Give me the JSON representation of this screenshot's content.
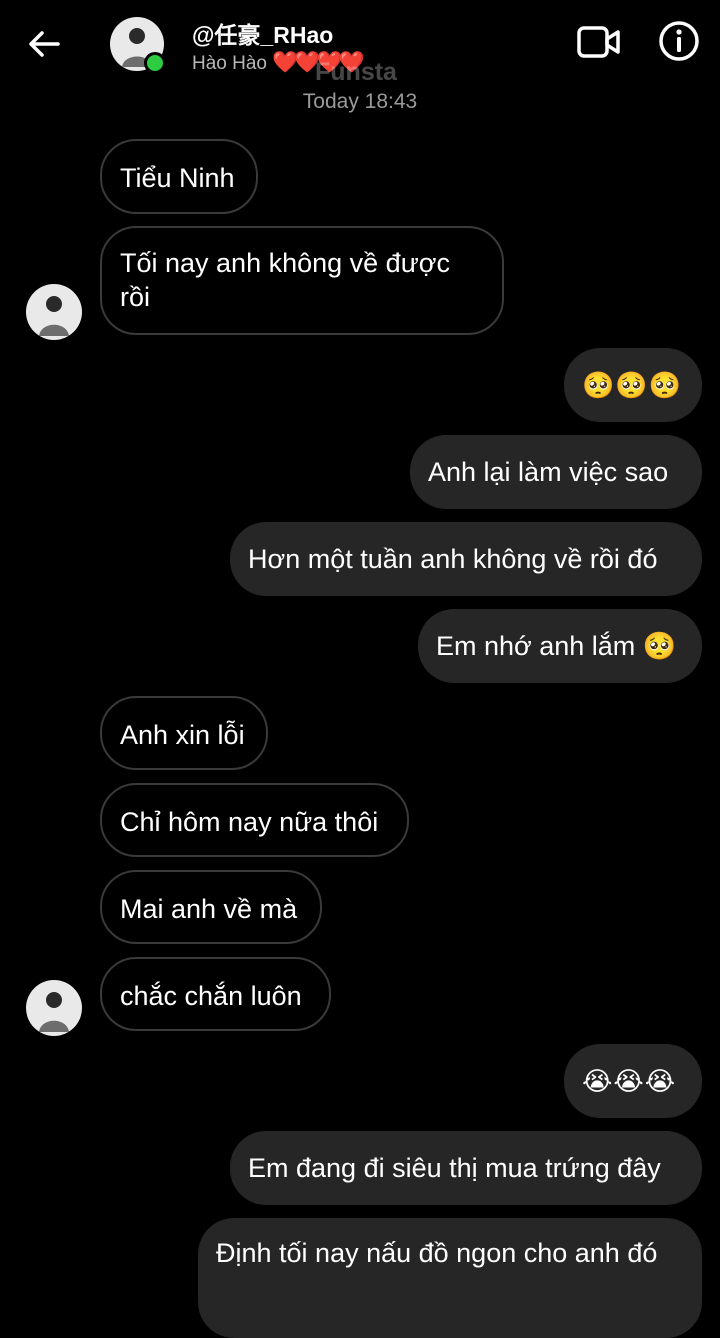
{
  "header": {
    "contact_name": "@任豪_RHao",
    "subtitle": "Hào Hào",
    "subtitle_hearts": "❤️❤️❤️❤️",
    "watermark": "Funsta"
  },
  "timestamp": "Today 18:43",
  "messages": [
    {
      "sender": "them",
      "text": "Tiểu Ninh"
    },
    {
      "sender": "them",
      "text": "Tối nay anh không về được rồi"
    },
    {
      "sender": "me",
      "text": "🥺🥺🥺"
    },
    {
      "sender": "me",
      "text": "Anh lại làm việc sao"
    },
    {
      "sender": "me",
      "text": "Hơn một tuần anh không về rồi đó"
    },
    {
      "sender": "me",
      "text": "Em nhớ anh lắm 🥺"
    },
    {
      "sender": "them",
      "text": "Anh xin lỗi"
    },
    {
      "sender": "them",
      "text": "Chỉ hôm nay nữa thôi"
    },
    {
      "sender": "them",
      "text": "Mai anh về mà"
    },
    {
      "sender": "them",
      "text": "chắc chắn luôn"
    },
    {
      "sender": "me",
      "text": "😭😭😭"
    },
    {
      "sender": "me",
      "text": "Em đang đi siêu thị mua trứng đây"
    },
    {
      "sender": "me",
      "text": "Định tối nay nấu đồ ngon cho anh đó"
    }
  ],
  "colors": {
    "background": "#000000",
    "outgoing_bubble": "#262626",
    "incoming_border": "#3a3a3a",
    "online": "#2ecc40",
    "hearts": "#e0242c"
  },
  "icons": [
    "back-arrow-icon",
    "video-call-icon",
    "info-icon",
    "avatar"
  ]
}
